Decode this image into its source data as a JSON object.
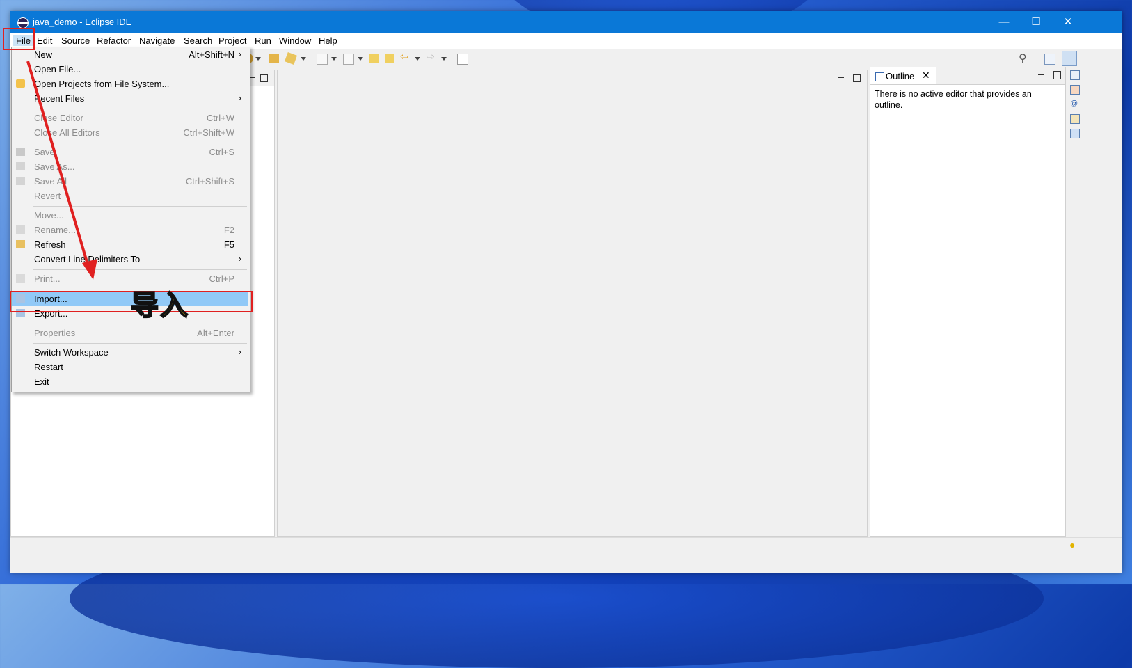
{
  "window": {
    "title": "java_demo - Eclipse IDE"
  },
  "menubar": {
    "items": [
      "File",
      "Edit",
      "Source",
      "Refactor",
      "Navigate",
      "Search",
      "Project",
      "Run",
      "Window",
      "Help"
    ]
  },
  "file_menu": {
    "items": [
      {
        "label": "New",
        "shortcut": "Alt+Shift+N",
        "submenu": true,
        "disabled": false
      },
      {
        "label": "Open File...",
        "shortcut": "",
        "disabled": false
      },
      {
        "label": "Open Projects from File System...",
        "shortcut": "",
        "disabled": false,
        "icon": "folder-icon"
      },
      {
        "label": "Recent Files",
        "shortcut": "",
        "submenu": true,
        "disabled": false
      },
      {
        "label": "Close Editor",
        "shortcut": "Ctrl+W",
        "disabled": true
      },
      {
        "label": "Close All Editors",
        "shortcut": "Ctrl+Shift+W",
        "disabled": true
      },
      {
        "label": "Save",
        "shortcut": "Ctrl+S",
        "disabled": true,
        "icon": "save-icon"
      },
      {
        "label": "Save As...",
        "shortcut": "",
        "disabled": true,
        "icon": "save-as-icon"
      },
      {
        "label": "Save All",
        "shortcut": "Ctrl+Shift+S",
        "disabled": true,
        "icon": "save-all-icon"
      },
      {
        "label": "Revert",
        "shortcut": "",
        "disabled": true
      },
      {
        "label": "Move...",
        "shortcut": "",
        "disabled": true
      },
      {
        "label": "Rename...",
        "shortcut": "F2",
        "disabled": true,
        "icon": "rename-icon"
      },
      {
        "label": "Refresh",
        "shortcut": "F5",
        "disabled": false,
        "icon": "refresh-icon"
      },
      {
        "label": "Convert Line Delimiters To",
        "shortcut": "",
        "submenu": true,
        "disabled": false
      },
      {
        "label": "Print...",
        "shortcut": "Ctrl+P",
        "disabled": true,
        "icon": "print-icon"
      },
      {
        "label": "Import...",
        "shortcut": "",
        "disabled": false,
        "highlighted": true,
        "icon": "import-icon"
      },
      {
        "label": "Export...",
        "shortcut": "",
        "disabled": false,
        "icon": "export-icon"
      },
      {
        "label": "Properties",
        "shortcut": "Alt+Enter",
        "disabled": true
      },
      {
        "label": "Switch Workspace",
        "shortcut": "",
        "submenu": true,
        "disabled": false
      },
      {
        "label": "Restart",
        "shortcut": "",
        "disabled": false
      },
      {
        "label": "Exit",
        "shortcut": "",
        "disabled": false
      }
    ]
  },
  "outline": {
    "tab_label": "Outline",
    "message": "There is no active editor that provides an outline."
  },
  "annotation": {
    "text": "导入"
  },
  "colors": {
    "titlebar": "#0a78d7",
    "highlight": "#91c9f7",
    "annotation_red": "#e02020",
    "annotation_text": "#ffcc00"
  }
}
